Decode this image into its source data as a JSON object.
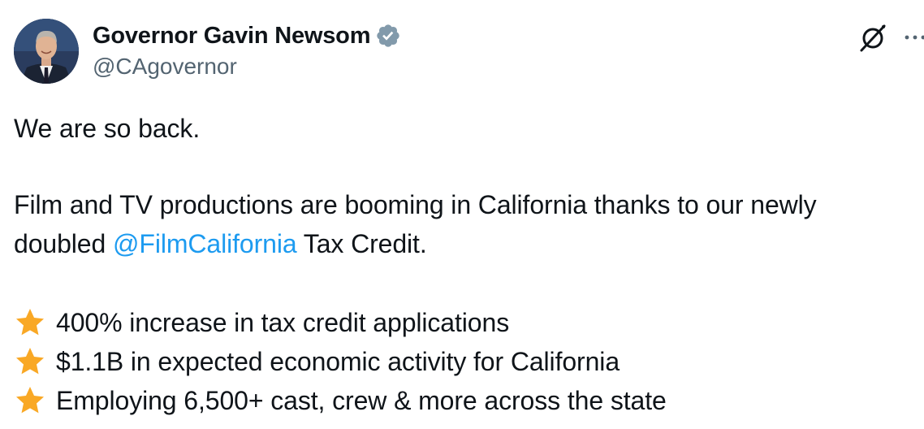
{
  "author": {
    "display_name": "Governor Gavin Newsom",
    "handle": "@CAgovernor",
    "verified_icon": "verified-badge-icon",
    "avatar": "avatar-photo"
  },
  "header_actions": {
    "grok_icon": "grok-slash-icon",
    "more_icon": "more-dots-icon"
  },
  "tweet": {
    "line1": "We are so back.",
    "line2": "Film and TV productions are booming in California thanks to our newly",
    "line3_prefix": "doubled ",
    "mention": "@FilmCalifornia",
    "line3_suffix": " Tax Credit.",
    "bullets": [
      {
        "icon": "star-icon",
        "text": "400% increase in tax credit applications"
      },
      {
        "icon": "star-icon",
        "text": "$1.1B in expected economic activity for California"
      },
      {
        "icon": "star-icon",
        "text": "Employing 6,500+ cast, crew & more across the state"
      }
    ]
  },
  "colors": {
    "text": "#0f1419",
    "secondary_text": "#536471",
    "mention": "#1d9bf0",
    "verified_badge": "#829aab",
    "star": "#f9a825"
  }
}
